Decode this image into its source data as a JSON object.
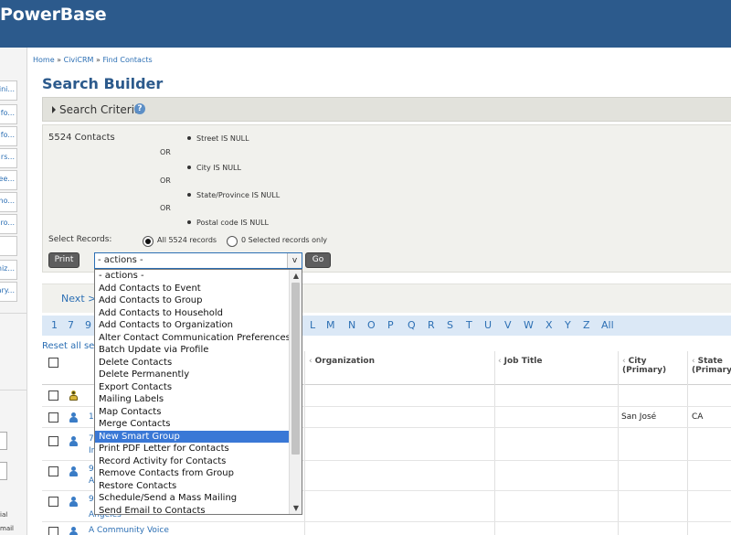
{
  "header": {
    "brand": "PowerBase",
    "color": "#2c5a8c"
  },
  "sidebar": {
    "items": [
      "Mini...",
      "ties fo...",
      "ties fo...",
      "rs...",
      "ee...",
      "borho...",
      "Gro...",
      "",
      "Organiz...",
      "rimary..."
    ],
    "bottom_labels": [
      "ial",
      "mail"
    ]
  },
  "breadcrumb": {
    "home": "Home",
    "civicrm": "CiviCRM",
    "find": "Find Contacts",
    "sep": "»"
  },
  "page": {
    "title": "Search Builder"
  },
  "criteria": {
    "header": "Search Criteria",
    "help_icon": "?",
    "count": "5524 Contacts",
    "conditions": [
      "Street IS NULL",
      "City IS NULL",
      "State/Province IS NULL",
      "Postal code IS NULL"
    ],
    "or_label": "OR"
  },
  "select_records": {
    "label": "Select Records:",
    "all_label": "All 5524 records",
    "selected_label": "0 Selected records only"
  },
  "buttons": {
    "print": "Print",
    "go": "Go"
  },
  "actions": {
    "selected": "- actions -",
    "arrow": "v",
    "options": [
      "- actions -",
      "Add Contacts to Event",
      "Add Contacts to Group",
      "Add Contacts to Household",
      "Add Contacts to Organization",
      "Alter Contact Communication Preferences",
      "Batch Update via Profile",
      "Delete Contacts",
      "Delete Permanently",
      "Export Contacts",
      "Mailing Labels",
      "Map Contacts",
      "Merge Contacts",
      "New Smart Group",
      "Print PDF Letter for Contacts",
      "Record Activity for Contacts",
      "Remove Contacts from Group",
      "Restore Contacts",
      "Schedule/Send a Mass Mailing",
      "Send Email to Contacts"
    ],
    "highlighted": "New Smart Group"
  },
  "pager": {
    "next": "Next >"
  },
  "alphabet": {
    "left": [
      "1",
      "7",
      "9"
    ],
    "right": [
      "L",
      "M",
      "N",
      "O",
      "P",
      "Q",
      "R",
      "S",
      "T",
      "U",
      "V",
      "W",
      "X",
      "Y",
      "Z",
      "All"
    ]
  },
  "table": {
    "reset": "Reset all sel",
    "columns": {
      "organization": "Organization",
      "job_title": "Job Title",
      "city": "City",
      "city_sub": "(Primary)",
      "state": "State",
      "state_sub": "(Primary"
    },
    "rows": [
      {
        "name": "",
        "city": "",
        "state": ""
      },
      {
        "name": "1(",
        "city": "San José",
        "state": "CA"
      },
      {
        "name": "7",
        "name2": "In",
        "city": "",
        "state": ""
      },
      {
        "name": "9",
        "name2": "A",
        "city": "",
        "state": ""
      },
      {
        "name": "9",
        "name2": "A",
        "city": "",
        "state": ""
      },
      {
        "name": "9",
        "name2": "Angeles",
        "city": "",
        "state": ""
      },
      {
        "name": "A Community Voice",
        "city": "",
        "state": ""
      }
    ]
  }
}
